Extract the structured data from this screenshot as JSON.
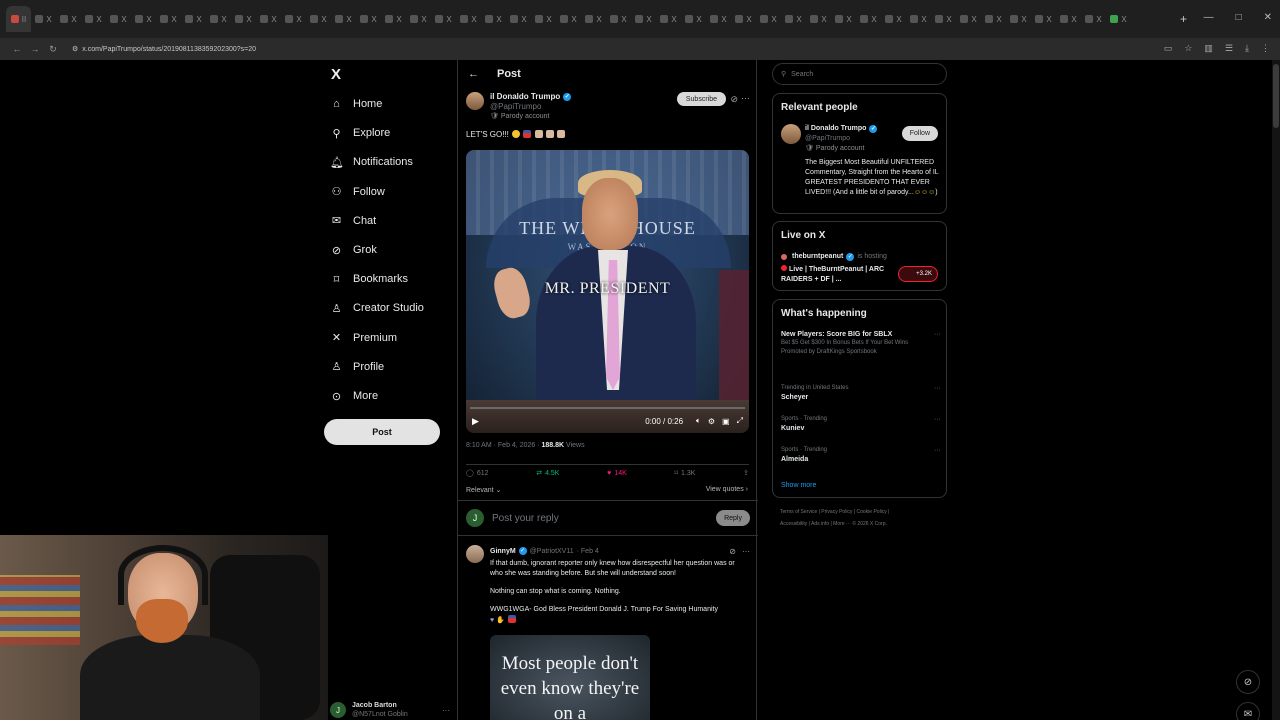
{
  "browser": {
    "url": "x.com/PapiTrumpo/status/2019081138359202300?s=20",
    "tab_letters": [
      "II",
      "X",
      "X",
      "X",
      "X",
      "X",
      "X",
      "X",
      "X",
      "X",
      "X",
      "X",
      "X",
      "X",
      "X",
      "X",
      "X",
      "X",
      "X",
      "X",
      "X",
      "X",
      "X",
      "X",
      "X",
      "X",
      "X",
      "X",
      "X",
      "X",
      "X",
      "X",
      "X",
      "X",
      "X",
      "X",
      "X",
      "X",
      "X",
      "X",
      "X",
      "X",
      "X",
      "X",
      "X"
    ]
  },
  "nav": {
    "logo": "X",
    "items": [
      {
        "label": "Home",
        "icon": "home-icon",
        "glyph": "⌂"
      },
      {
        "label": "Explore",
        "icon": "search-icon",
        "glyph": "⚲"
      },
      {
        "label": "Notifications",
        "icon": "bell-icon",
        "glyph": "🔔︎"
      },
      {
        "label": "Follow",
        "icon": "add-person-icon",
        "glyph": "⚇"
      },
      {
        "label": "Chat",
        "icon": "mail-icon",
        "glyph": "✉"
      },
      {
        "label": "Grok",
        "icon": "grok-icon",
        "glyph": "⊘"
      },
      {
        "label": "Bookmarks",
        "icon": "bookmark-icon",
        "glyph": "⌑"
      },
      {
        "label": "Creator Studio",
        "icon": "creator-icon",
        "glyph": "♙"
      },
      {
        "label": "Premium",
        "icon": "x-icon",
        "glyph": "✕"
      },
      {
        "label": "Profile",
        "icon": "profile-icon",
        "glyph": "♙"
      },
      {
        "label": "More",
        "icon": "more-circle-icon",
        "glyph": "⊙"
      }
    ],
    "post_button": "Post",
    "account": {
      "name": "Jacob Barton",
      "handle": "@N57Lnot Goblin",
      "initial": "J"
    }
  },
  "main": {
    "title": "Post",
    "post": {
      "author": "il Donaldo Trumpo",
      "handle": "@PapiTrumpo",
      "parody_label": "Parody account",
      "subscribe": "Subscribe",
      "text": "LET'S GO!!!",
      "video": {
        "banner_text": "THE WHITE HOUSE",
        "banner_sub": "WASHINGTON",
        "caption": "MR. PRESIDENT",
        "time": "0:00 / 0:26"
      },
      "timestamp": "8:10 AM · Feb 4, 2026 · ",
      "views_count": "188.8K",
      "views_label": " Views",
      "stats": {
        "replies": "612",
        "reposts": "4.5K",
        "likes": "14K",
        "bookmarks": "1.3K"
      },
      "sort_label": "Relevant",
      "view_quotes": "View quotes"
    },
    "reply_box": {
      "placeholder": "Post your reply",
      "button": "Reply",
      "initial": "J"
    },
    "comment": {
      "author": "GinnyM",
      "handle": "@PatriotXV11",
      "date": "· Feb 4",
      "lines": [
        "If that dumb, ignorant reporter only knew how disrespectful her question was or who she was standing before. But she will understand soon!",
        "Nothing can stop what is coming. Nothing.",
        "WWG1WGA- God Bless President Donald J. Trump For Saving Humanity"
      ],
      "image_text": "Most people don't even know they're on a"
    }
  },
  "right": {
    "search_placeholder": "Search",
    "relevant_people": {
      "title": "Relevant people",
      "name": "il Donaldo Trumpo",
      "handle": "@PapiTrumpo",
      "parody_label": "Parody account",
      "follow": "Follow",
      "bio": "The Biggest Most Beautiful UNFILTERED Commentary, Straight from the Hearto of IL GREATEST PRESIDENTO THAT EVER LIVED!!! (And a little bit of parody..."
    },
    "live": {
      "title": "Live on X",
      "host": "theburntpeanut",
      "host_status": "is hosting",
      "stream_title": "Live | TheBurntPeanut | ARC RAIDERS + DF | ...",
      "listeners": "+3.2K"
    },
    "happening": {
      "title": "What's happening",
      "items": [
        {
          "context": "",
          "title": "New Players: Score BIG for SBLX",
          "desc": "Bet $5 Get $300 In Bonus Bets If Your Bet Wins",
          "promo": "Promoted by DraftKings Sportsbook"
        },
        {
          "context": "Trending in United States",
          "title": "Scheyer",
          "desc": "",
          "promo": ""
        },
        {
          "context": "Sports · Trending",
          "title": "Kuniev",
          "desc": "",
          "promo": ""
        },
        {
          "context": "Sports · Trending",
          "title": "Almeida",
          "desc": "",
          "promo": ""
        }
      ],
      "show_more": "Show more"
    },
    "footer": {
      "line1": "Terms of Service  |  Privacy Policy  |  Cookie Policy  |",
      "line2": "Accessibility  |  Ads info  |  More ···  © 2026 X Corp."
    }
  }
}
